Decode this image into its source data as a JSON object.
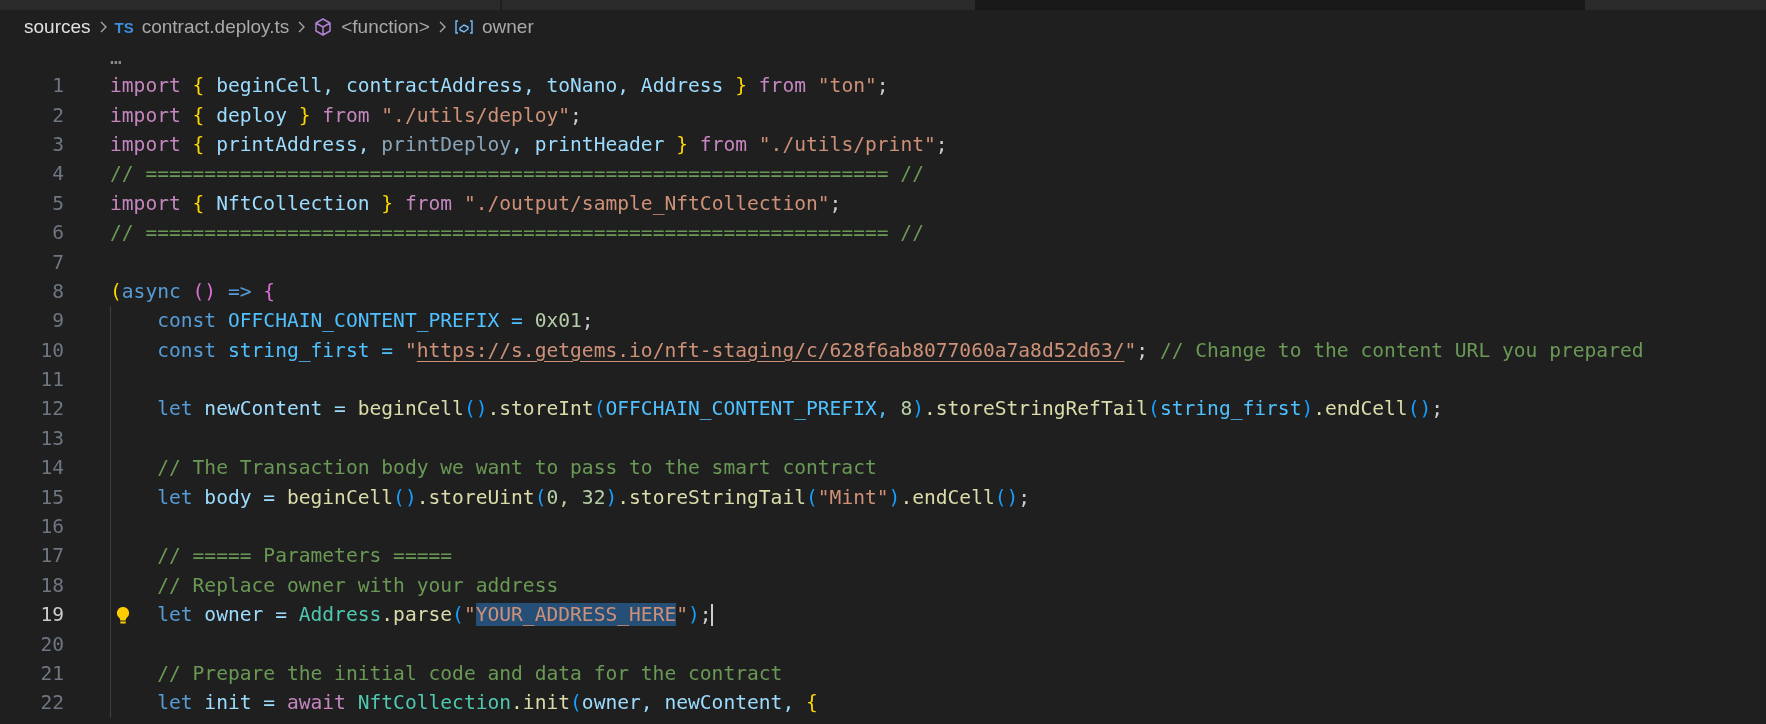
{
  "breadcrumb": [
    {
      "kind": "folder",
      "label": "sources"
    },
    {
      "kind": "file",
      "badge": "TS",
      "label": "contract.deploy.ts"
    },
    {
      "kind": "function",
      "label": "<function>"
    },
    {
      "kind": "variable",
      "label": "owner"
    }
  ],
  "folded_marker": "…",
  "lines": [
    {
      "number": "1",
      "tokens": [
        {
          "text": "import ",
          "kind": "keyword"
        },
        {
          "text": "{ ",
          "kind": "br1"
        },
        {
          "text": "beginCell, contractAddress, toNano, Address ",
          "kind": "var"
        },
        {
          "text": "} ",
          "kind": "br1"
        },
        {
          "text": "from ",
          "kind": "keyword"
        },
        {
          "text": "\"ton\"",
          "kind": "string"
        },
        {
          "text": ";",
          "kind": "plain"
        }
      ]
    },
    {
      "number": "2",
      "tokens": [
        {
          "text": "import ",
          "kind": "keyword"
        },
        {
          "text": "{ ",
          "kind": "br1"
        },
        {
          "text": "deploy ",
          "kind": "var"
        },
        {
          "text": "} ",
          "kind": "br1"
        },
        {
          "text": "from ",
          "kind": "keyword"
        },
        {
          "text": "\"./utils/deploy\"",
          "kind": "string"
        },
        {
          "text": ";",
          "kind": "plain"
        }
      ]
    },
    {
      "number": "3",
      "tokens": [
        {
          "text": "import ",
          "kind": "keyword"
        },
        {
          "text": "{ ",
          "kind": "br1"
        },
        {
          "text": "printAddress, ",
          "kind": "var"
        },
        {
          "text": "printDeploy",
          "kind": "unused"
        },
        {
          "text": ", printHeader ",
          "kind": "var"
        },
        {
          "text": "} ",
          "kind": "br1"
        },
        {
          "text": "from ",
          "kind": "keyword"
        },
        {
          "text": "\"./utils/print\"",
          "kind": "string"
        },
        {
          "text": ";",
          "kind": "plain"
        }
      ]
    },
    {
      "number": "4",
      "tokens": [
        {
          "text": "// =============================================================== //",
          "kind": "comment"
        }
      ]
    },
    {
      "number": "5",
      "tokens": [
        {
          "text": "import ",
          "kind": "keyword"
        },
        {
          "text": "{ ",
          "kind": "br1"
        },
        {
          "text": "NftCollection ",
          "kind": "var"
        },
        {
          "text": "} ",
          "kind": "br1"
        },
        {
          "text": "from ",
          "kind": "keyword"
        },
        {
          "text": "\"./output/sample_NftCollection\"",
          "kind": "string"
        },
        {
          "text": ";",
          "kind": "plain"
        }
      ]
    },
    {
      "number": "6",
      "tokens": [
        {
          "text": "// =============================================================== //",
          "kind": "comment"
        }
      ]
    },
    {
      "number": "7"
    },
    {
      "number": "8",
      "tokens": [
        {
          "text": "(",
          "kind": "br1"
        },
        {
          "text": "async ",
          "kind": "storage"
        },
        {
          "text": "() ",
          "kind": "br2"
        },
        {
          "text": "=> ",
          "kind": "storage"
        },
        {
          "text": "{",
          "kind": "br2"
        }
      ],
      "children": [
        {
          "number": "9",
          "tokens": [
            {
              "text": "const ",
              "kind": "storage"
            },
            {
              "text": "OFFCHAIN_CONTENT_PREFIX = ",
              "kind": "const"
            },
            {
              "text": "0x01",
              "kind": "number"
            },
            {
              "text": ";",
              "kind": "plain"
            }
          ]
        },
        {
          "number": "10",
          "tokens": [
            {
              "text": "const ",
              "kind": "storage"
            },
            {
              "text": "string_first = ",
              "kind": "const"
            },
            {
              "text": "\"",
              "kind": "string"
            },
            {
              "text": "https://s.getgems.io/nft-staging/c/628f6ab8077060a7a8d52d63/",
              "kind": "link"
            },
            {
              "text": "\"",
              "kind": "string"
            },
            {
              "text": "; ",
              "kind": "plain"
            },
            {
              "text": "// Change to the content URL you prepared",
              "kind": "comment"
            }
          ]
        },
        {
          "number": "11"
        },
        {
          "number": "12",
          "tokens": [
            {
              "text": "let ",
              "kind": "storage"
            },
            {
              "text": "newContent = ",
              "kind": "var"
            },
            {
              "text": "beginCell",
              "kind": "fn"
            },
            {
              "text": "()",
              "kind": "br3"
            },
            {
              "text": ".storeInt",
              "kind": "fn"
            },
            {
              "text": "(",
              "kind": "br3"
            },
            {
              "text": "OFFCHAIN_CONTENT_PREFIX, ",
              "kind": "const"
            },
            {
              "text": "8",
              "kind": "number"
            },
            {
              "text": ")",
              "kind": "br3"
            },
            {
              "text": ".storeStringRefTail",
              "kind": "fn"
            },
            {
              "text": "(",
              "kind": "br3"
            },
            {
              "text": "string_first",
              "kind": "const"
            },
            {
              "text": ")",
              "kind": "br3"
            },
            {
              "text": ".endCell",
              "kind": "fn"
            },
            {
              "text": "()",
              "kind": "br3"
            },
            {
              "text": ";",
              "kind": "plain"
            }
          ]
        },
        {
          "number": "13"
        },
        {
          "number": "14",
          "tokens": [
            {
              "text": "// The Transaction body we want to pass to the smart contract",
              "kind": "comment"
            }
          ]
        },
        {
          "number": "15",
          "tokens": [
            {
              "text": "let ",
              "kind": "storage"
            },
            {
              "text": "body = ",
              "kind": "var"
            },
            {
              "text": "beginCell",
              "kind": "fn"
            },
            {
              "text": "()",
              "kind": "br3"
            },
            {
              "text": ".storeUint",
              "kind": "fn"
            },
            {
              "text": "(",
              "kind": "br3"
            },
            {
              "text": "0, 32",
              "kind": "number"
            },
            {
              "text": ")",
              "kind": "br3"
            },
            {
              "text": ".storeStringTail",
              "kind": "fn"
            },
            {
              "text": "(",
              "kind": "br3"
            },
            {
              "text": "\"Mint\"",
              "kind": "string"
            },
            {
              "text": ")",
              "kind": "br3"
            },
            {
              "text": ".endCell",
              "kind": "fn"
            },
            {
              "text": "()",
              "kind": "br3"
            },
            {
              "text": ";",
              "kind": "plain"
            }
          ]
        },
        {
          "number": "16"
        },
        {
          "number": "17",
          "tokens": [
            {
              "text": "// ===== Parameters =====",
              "kind": "comment"
            }
          ]
        },
        {
          "number": "18",
          "tokens": [
            {
              "text": "// Replace owner with your address",
              "kind": "comment"
            }
          ]
        },
        {
          "number": "19",
          "current": true,
          "lightbulb": true,
          "tokens": [
            {
              "text": "let ",
              "kind": "storage"
            },
            {
              "text": "owner = ",
              "kind": "var"
            },
            {
              "text": "Address",
              "kind": "type"
            },
            {
              "text": ".parse",
              "kind": "fn"
            },
            {
              "text": "(",
              "kind": "br3"
            },
            {
              "text": "\"",
              "kind": "string"
            },
            {
              "text": "YOUR_ADDRESS_HERE",
              "kind": "string",
              "selected": true
            },
            {
              "text": "\"",
              "kind": "string"
            },
            {
              "text": ")",
              "kind": "br3"
            },
            {
              "text": ";",
              "kind": "plain"
            }
          ]
        },
        {
          "number": "20"
        },
        {
          "number": "21",
          "tokens": [
            {
              "text": "// Prepare the initial code and data for the contract",
              "kind": "comment"
            }
          ]
        },
        {
          "number": "22",
          "tokens": [
            {
              "text": "let ",
              "kind": "storage"
            },
            {
              "text": "init = ",
              "kind": "var"
            },
            {
              "text": "await ",
              "kind": "keyword"
            },
            {
              "text": "NftCollection",
              "kind": "type"
            },
            {
              "text": ".init",
              "kind": "fn"
            },
            {
              "text": "(",
              "kind": "br3"
            },
            {
              "text": "owner, newContent, ",
              "kind": "var"
            },
            {
              "text": "{",
              "kind": "br1"
            }
          ]
        }
      ]
    }
  ]
}
